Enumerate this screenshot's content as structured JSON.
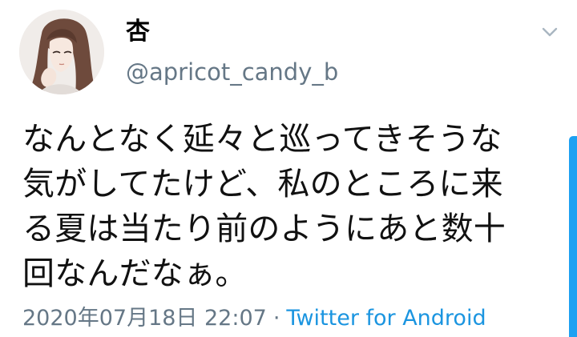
{
  "user": {
    "display_name": "杏",
    "handle": "@apricot_candy_b",
    "avatar_icon": "illustrated-girl-avatar"
  },
  "menu": {
    "caret_icon": "chevron-down-icon"
  },
  "tweet": {
    "text": "なんとなく延々と巡ってきそうな\n気がしてたけど、私のところに来\nる夏は当たり前のようにあと数十\n回なんだなぁ。",
    "timestamp": "2020年07月18日 22:07",
    "separator": "·",
    "source": "Twitter for Android"
  },
  "colors": {
    "accent": "#1da1f2",
    "secondary_text": "#657786"
  }
}
